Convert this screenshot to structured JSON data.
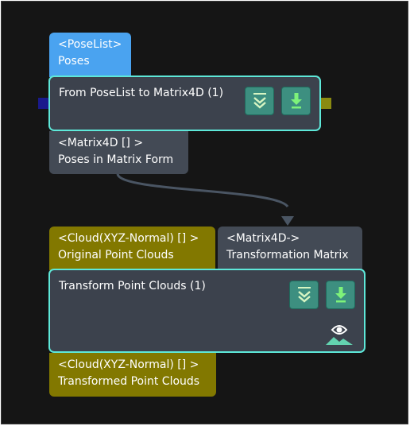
{
  "nodes": [
    {
      "title": "From PoseList to Matrix4D (1)",
      "inputs": [
        {
          "type": "<PoseList>",
          "name": "Poses"
        }
      ],
      "outputs": [
        {
          "type": "<Matrix4D [] >",
          "name": "Poses in Matrix Form"
        }
      ],
      "buttons": [
        "collapse-icon",
        "download-icon"
      ]
    },
    {
      "title": "Transform Point Clouds (1)",
      "inputs": [
        {
          "type": "<Cloud(XYZ-Normal) [] >",
          "name": "Original Point Clouds"
        },
        {
          "type": "<Matrix4D->",
          "name": "Transformation Matrix"
        }
      ],
      "outputs": [
        {
          "type": "<Cloud(XYZ-Normal) [] >",
          "name": "Transformed Point Clouds"
        }
      ],
      "buttons": [
        "collapse-icon",
        "download-icon"
      ],
      "badge_icon": "visualize-eye-icon"
    }
  ],
  "colors": {
    "canvas_bg": "#151515",
    "node_bg": "#3c424d",
    "node_border": "#5ee8d9",
    "button_bg": "#3d8f80",
    "port_poselist": "#4aa3f0",
    "port_cloud": "#827800",
    "port_matrix": "#434a55",
    "connection": "#4a5563",
    "left_connector": "#1a1a8c",
    "right_connector": "#8a8a10"
  }
}
